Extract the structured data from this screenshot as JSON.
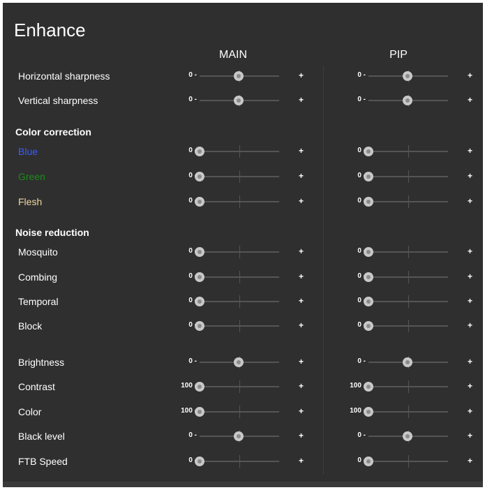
{
  "title": "Enhance",
  "columns": {
    "main": "MAIN",
    "pip": "PIP"
  },
  "colors": {
    "panel_bg": "#2f2f2f",
    "blue_label": "#3a5cff",
    "green_label": "#1c8a1c",
    "flesh_label": "#f0d8a0"
  },
  "plus_symbol": "+",
  "rows": [
    {
      "label": "Horizontal sharpness",
      "main_min": "0 -",
      "main_value": 0.5,
      "pip_min": "0 -",
      "pip_value": 0.5
    },
    {
      "label": "Vertical sharpness",
      "main_min": "0 -",
      "main_value": 0.5,
      "pip_min": "0 -",
      "pip_value": 0.5
    },
    {
      "section": "Color correction"
    },
    {
      "label": "Blue",
      "color": "#3a5cff",
      "main_min": "0 -",
      "main_value": 0,
      "pip_min": "0 -",
      "pip_value": 0
    },
    {
      "label": "Green",
      "color": "#1c8a1c",
      "main_min": "0 -",
      "main_value": 0,
      "pip_min": "0 -",
      "pip_value": 0
    },
    {
      "label": "Flesh",
      "color": "#f0d8a0",
      "main_min": "0 -",
      "main_value": 0,
      "pip_min": "0 -",
      "pip_value": 0
    },
    {
      "section": "Noise reduction"
    },
    {
      "label": "Mosquito",
      "main_min": "0 -",
      "main_value": 0,
      "pip_min": "0 -",
      "pip_value": 0
    },
    {
      "label": "Combing",
      "main_min": "0 -",
      "main_value": 0,
      "pip_min": "0 -",
      "pip_value": 0
    },
    {
      "label": "Temporal",
      "main_min": "0 -",
      "main_value": 0,
      "pip_min": "0 -",
      "pip_value": 0
    },
    {
      "label": "Block",
      "main_min": "0 -",
      "main_value": 0,
      "pip_min": "0 -",
      "pip_value": 0
    },
    {
      "label": "Brightness",
      "main_min": "0 -",
      "main_value": 0.5,
      "pip_min": "0 -",
      "pip_value": 0.5
    },
    {
      "label": "Contrast",
      "main_min": "100 -",
      "main_value": 0,
      "pip_min": "100 -",
      "pip_value": 0
    },
    {
      "label": "Color",
      "main_min": "100 -",
      "main_value": 0,
      "pip_min": "100 -",
      "pip_value": 0
    },
    {
      "label": "Black level",
      "main_min": "0 -",
      "main_value": 0.5,
      "pip_min": "0 -",
      "pip_value": 0.5
    },
    {
      "label": "FTB Speed",
      "main_min": "0 -",
      "main_value": 0,
      "pip_min": "0 -",
      "pip_value": 0
    }
  ]
}
